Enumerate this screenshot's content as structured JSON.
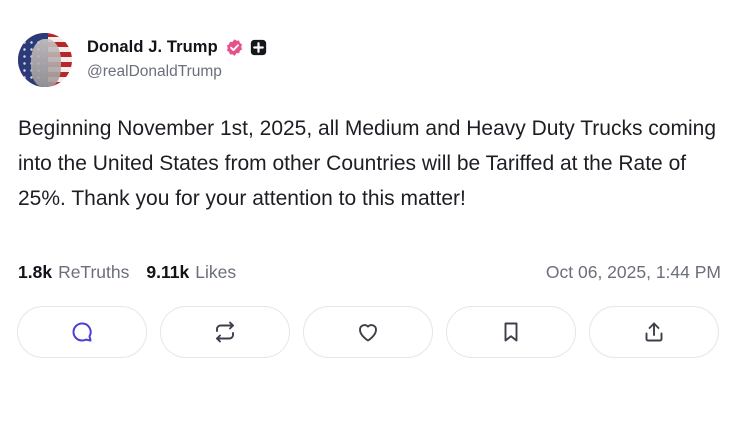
{
  "author": {
    "display_name": "Donald J. Trump",
    "handle": "@realDonaldTrump",
    "verified_badge_color": "#e8508a"
  },
  "post": {
    "text": "Beginning November 1st, 2025, all Medium and Heavy Duty Trucks coming into the United States from other Countries will be Tariffed at the Rate of 25%. Thank you for your attention to this matter!"
  },
  "stats": {
    "retruths_count": "1.8k",
    "retruths_label": "ReTruths",
    "likes_count": "9.11k",
    "likes_label": "Likes",
    "timestamp": "Oct 06, 2025, 1:44 PM"
  },
  "actions": [
    {
      "icon": "reply-icon",
      "color": "#4b3fd8"
    },
    {
      "icon": "retruth-icon",
      "color": "#3b3f4a"
    },
    {
      "icon": "like-icon",
      "color": "#3b3f4a"
    },
    {
      "icon": "bookmark-icon",
      "color": "#3b3f4a"
    },
    {
      "icon": "share-icon",
      "color": "#3b3f4a"
    }
  ]
}
